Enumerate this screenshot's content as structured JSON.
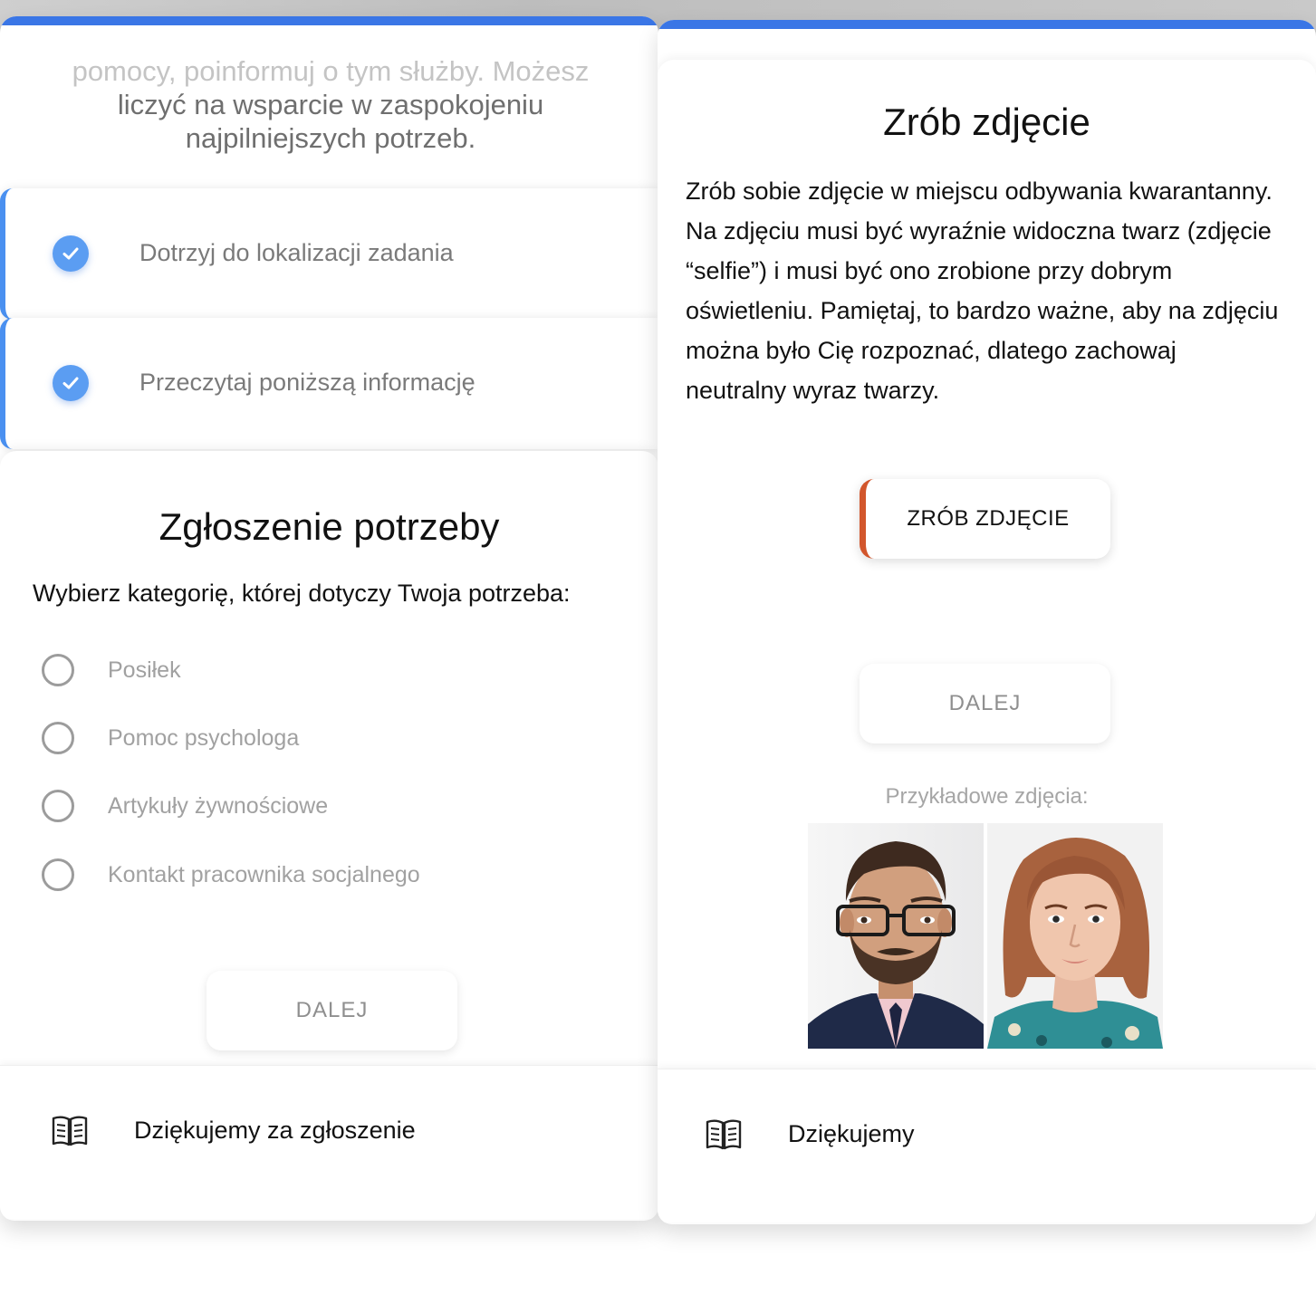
{
  "left_panel": {
    "intro_fade": "pomocy, poinformuj o tym służby. Możesz",
    "intro_lines": [
      "liczyć na wsparcie w zaspokojeniu",
      "najpilniejszych potrzeb."
    ],
    "steps": [
      {
        "label": "Dotrzyj do lokalizacji zadania",
        "done": true
      },
      {
        "label": "Przeczytaj poniższą informację",
        "done": true
      }
    ],
    "title": "Zgłoszenie potrzeby",
    "subtitle": "Wybierz kategorię, której dotyczy Twoja potrzeba:",
    "options": [
      "Posiłek",
      "Pomoc psychologa",
      "Artykuły żywnościowe",
      "Kontakt pracownika socjalnego"
    ],
    "next_button": "DALEJ",
    "footer": {
      "icon": "book-icon",
      "label": "Dziękujemy za zgłoszenie"
    }
  },
  "right_panel": {
    "title": "Zrób zdjęcie",
    "paragraph": "Zrób sobie zdjęcie w miejscu odbywania kwarantanny. Na zdjęciu musi być wyraźnie widoczna twarz (zdjęcie “selfie”) i musi być ono zrobione przy dobrym oświetleniu. Pamiętaj, to bardzo ważne, aby na zdjęciu można było Cię rozpoznać, dlatego zachowaj neutralny wyraz twarzy.",
    "take_photo_button": "ZRÓB ZDJĘCIE",
    "next_button": "DALEJ",
    "examples_label": "Przykładowe zdjęcia:",
    "footer": {
      "icon": "book-icon",
      "label": "Dziękujemy"
    }
  },
  "colors": {
    "accent_blue": "#3a76e6",
    "check_blue": "#5b9df2",
    "accent_orange": "#d2562c"
  }
}
